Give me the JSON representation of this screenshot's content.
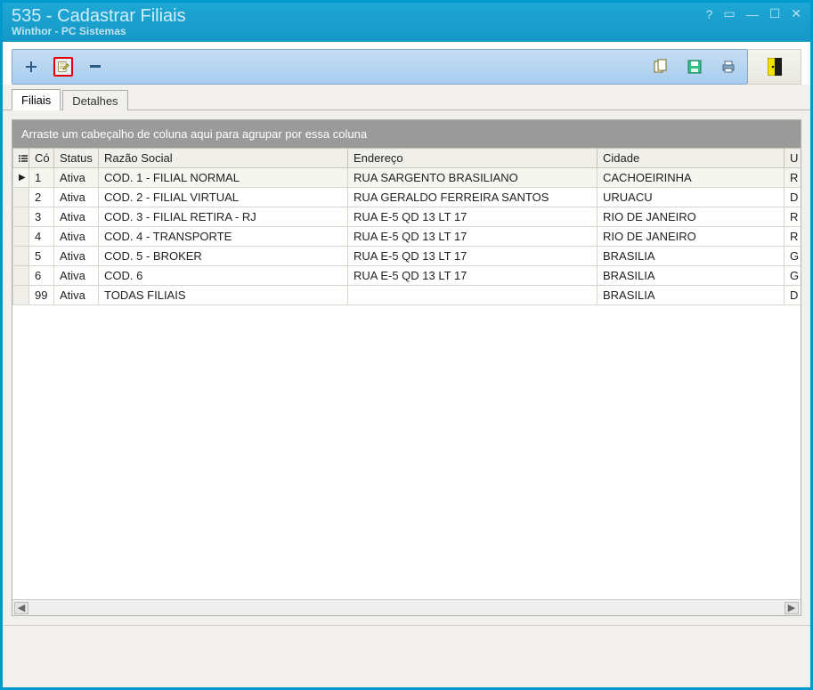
{
  "window": {
    "title": "535 - Cadastrar Filiais",
    "subtitle": "Winthor - PC Sistemas"
  },
  "tabs": {
    "filiais": "Filiais",
    "detalhes": "Detalhes"
  },
  "grid": {
    "group_hint": "Arraste um cabeçalho de coluna aqui para agrupar por essa coluna",
    "headers": {
      "cod": "Có",
      "status": "Status",
      "razao": "Razão Social",
      "endereco": "Endereço",
      "cidade": "Cidade",
      "tail": "U"
    },
    "rows": [
      {
        "cod": "1",
        "status": "Ativa",
        "razao": "COD. 1 - FILIAL NORMAL",
        "endereco": "RUA SARGENTO BRASILIANO",
        "cidade": "CACHOEIRINHA",
        "tail": "R"
      },
      {
        "cod": "2",
        "status": "Ativa",
        "razao": "COD. 2 - FILIAL VIRTUAL",
        "endereco": "RUA GERALDO FERREIRA SANTOS",
        "cidade": "URUACU",
        "tail": "D"
      },
      {
        "cod": "3",
        "status": "Ativa",
        "razao": "COD. 3 - FILIAL RETIRA - RJ",
        "endereco": "RUA E-5 QD 13 LT 17",
        "cidade": "RIO DE JANEIRO",
        "tail": "R"
      },
      {
        "cod": "4",
        "status": "Ativa",
        "razao": "COD. 4 - TRANSPORTE",
        "endereco": "RUA E-5 QD 13 LT 17",
        "cidade": "RIO DE JANEIRO",
        "tail": "R"
      },
      {
        "cod": "5",
        "status": "Ativa",
        "razao": "COD. 5 - BROKER",
        "endereco": "RUA E-5 QD 13 LT 17",
        "cidade": "BRASILIA",
        "tail": "G"
      },
      {
        "cod": "6",
        "status": "Ativa",
        "razao": "COD. 6",
        "endereco": "RUA E-5 QD 13 LT 17",
        "cidade": "BRASILIA",
        "tail": "G"
      },
      {
        "cod": "99",
        "status": "Ativa",
        "razao": "TODAS FILIAIS",
        "endereco": "",
        "cidade": "BRASILIA",
        "tail": "D"
      }
    ]
  }
}
